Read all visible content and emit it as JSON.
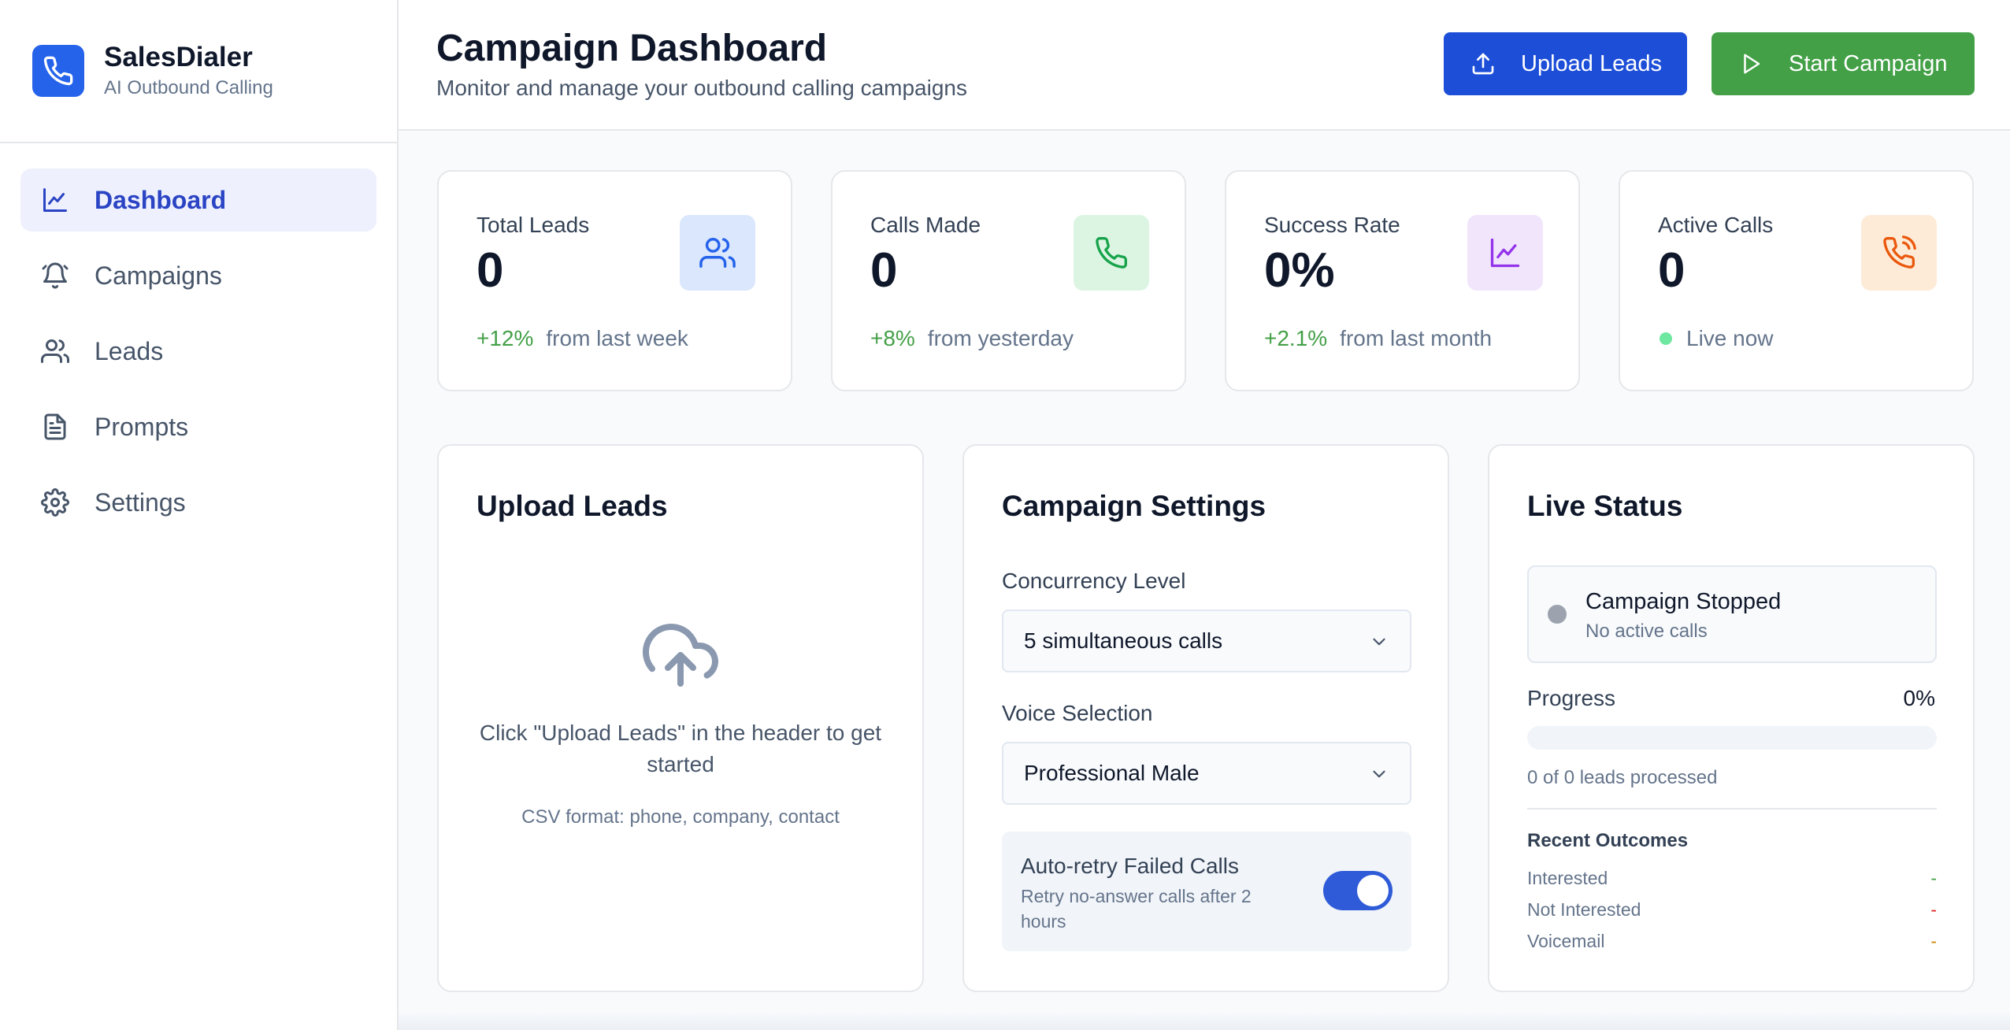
{
  "brand": {
    "name": "SalesDialer",
    "tagline": "AI Outbound Calling"
  },
  "nav": {
    "items": [
      {
        "label": "Dashboard",
        "icon": "chart-line-icon",
        "active": true
      },
      {
        "label": "Campaigns",
        "icon": "bell-icon",
        "active": false
      },
      {
        "label": "Leads",
        "icon": "users-icon",
        "active": false
      },
      {
        "label": "Prompts",
        "icon": "document-icon",
        "active": false
      },
      {
        "label": "Settings",
        "icon": "gear-icon",
        "active": false
      }
    ]
  },
  "header": {
    "title": "Campaign Dashboard",
    "subtitle": "Monitor and manage your outbound calling campaigns",
    "upload_label": "Upload Leads",
    "start_label": "Start Campaign"
  },
  "stats": [
    {
      "title": "Total Leads",
      "value": "0",
      "delta": "+12%",
      "foot": "from last week",
      "icon": "users-icon",
      "color": "#2563eb"
    },
    {
      "title": "Calls Made",
      "value": "0",
      "delta": "+8%",
      "foot": "from yesterday",
      "icon": "phone-icon",
      "color": "#16a34a"
    },
    {
      "title": "Success Rate",
      "value": "0%",
      "delta": "+2.1%",
      "foot": "from last month",
      "icon": "chart-line-icon",
      "color": "#9333ea"
    },
    {
      "title": "Active Calls",
      "value": "0",
      "delta": "",
      "foot": "Live now",
      "icon": "phone-ringing-icon",
      "color": "#ea580c"
    }
  ],
  "upload_panel": {
    "title": "Upload Leads",
    "hint": "Click \"Upload Leads\" in the header to get started",
    "format": "CSV format: phone, company, contact"
  },
  "settings_panel": {
    "title": "Campaign Settings",
    "concurrency_label": "Concurrency Level",
    "concurrency_value": "5 simultaneous calls",
    "voice_label": "Voice Selection",
    "voice_value": "Professional Male",
    "retry_title": "Auto-retry Failed Calls",
    "retry_desc": "Retry no-answer calls after 2 hours",
    "retry_enabled": true
  },
  "status_panel": {
    "title": "Live Status",
    "status_title": "Campaign Stopped",
    "status_sub": "No active calls",
    "progress_label": "Progress",
    "progress_value": "0%",
    "progress_fraction": 0,
    "progress_caption": "0 of 0 leads processed",
    "outcomes_title": "Recent Outcomes",
    "outcomes": [
      {
        "label": "Interested",
        "value": "-",
        "color": "#43a047"
      },
      {
        "label": "Not Interested",
        "value": "-",
        "color": "#dc2626"
      },
      {
        "label": "Voicemail",
        "value": "-",
        "color": "#ca8a04"
      }
    ]
  },
  "colors": {
    "primary": "#1d4ed8",
    "success": "#43a047",
    "active_nav_bg": "#eef0fd"
  }
}
